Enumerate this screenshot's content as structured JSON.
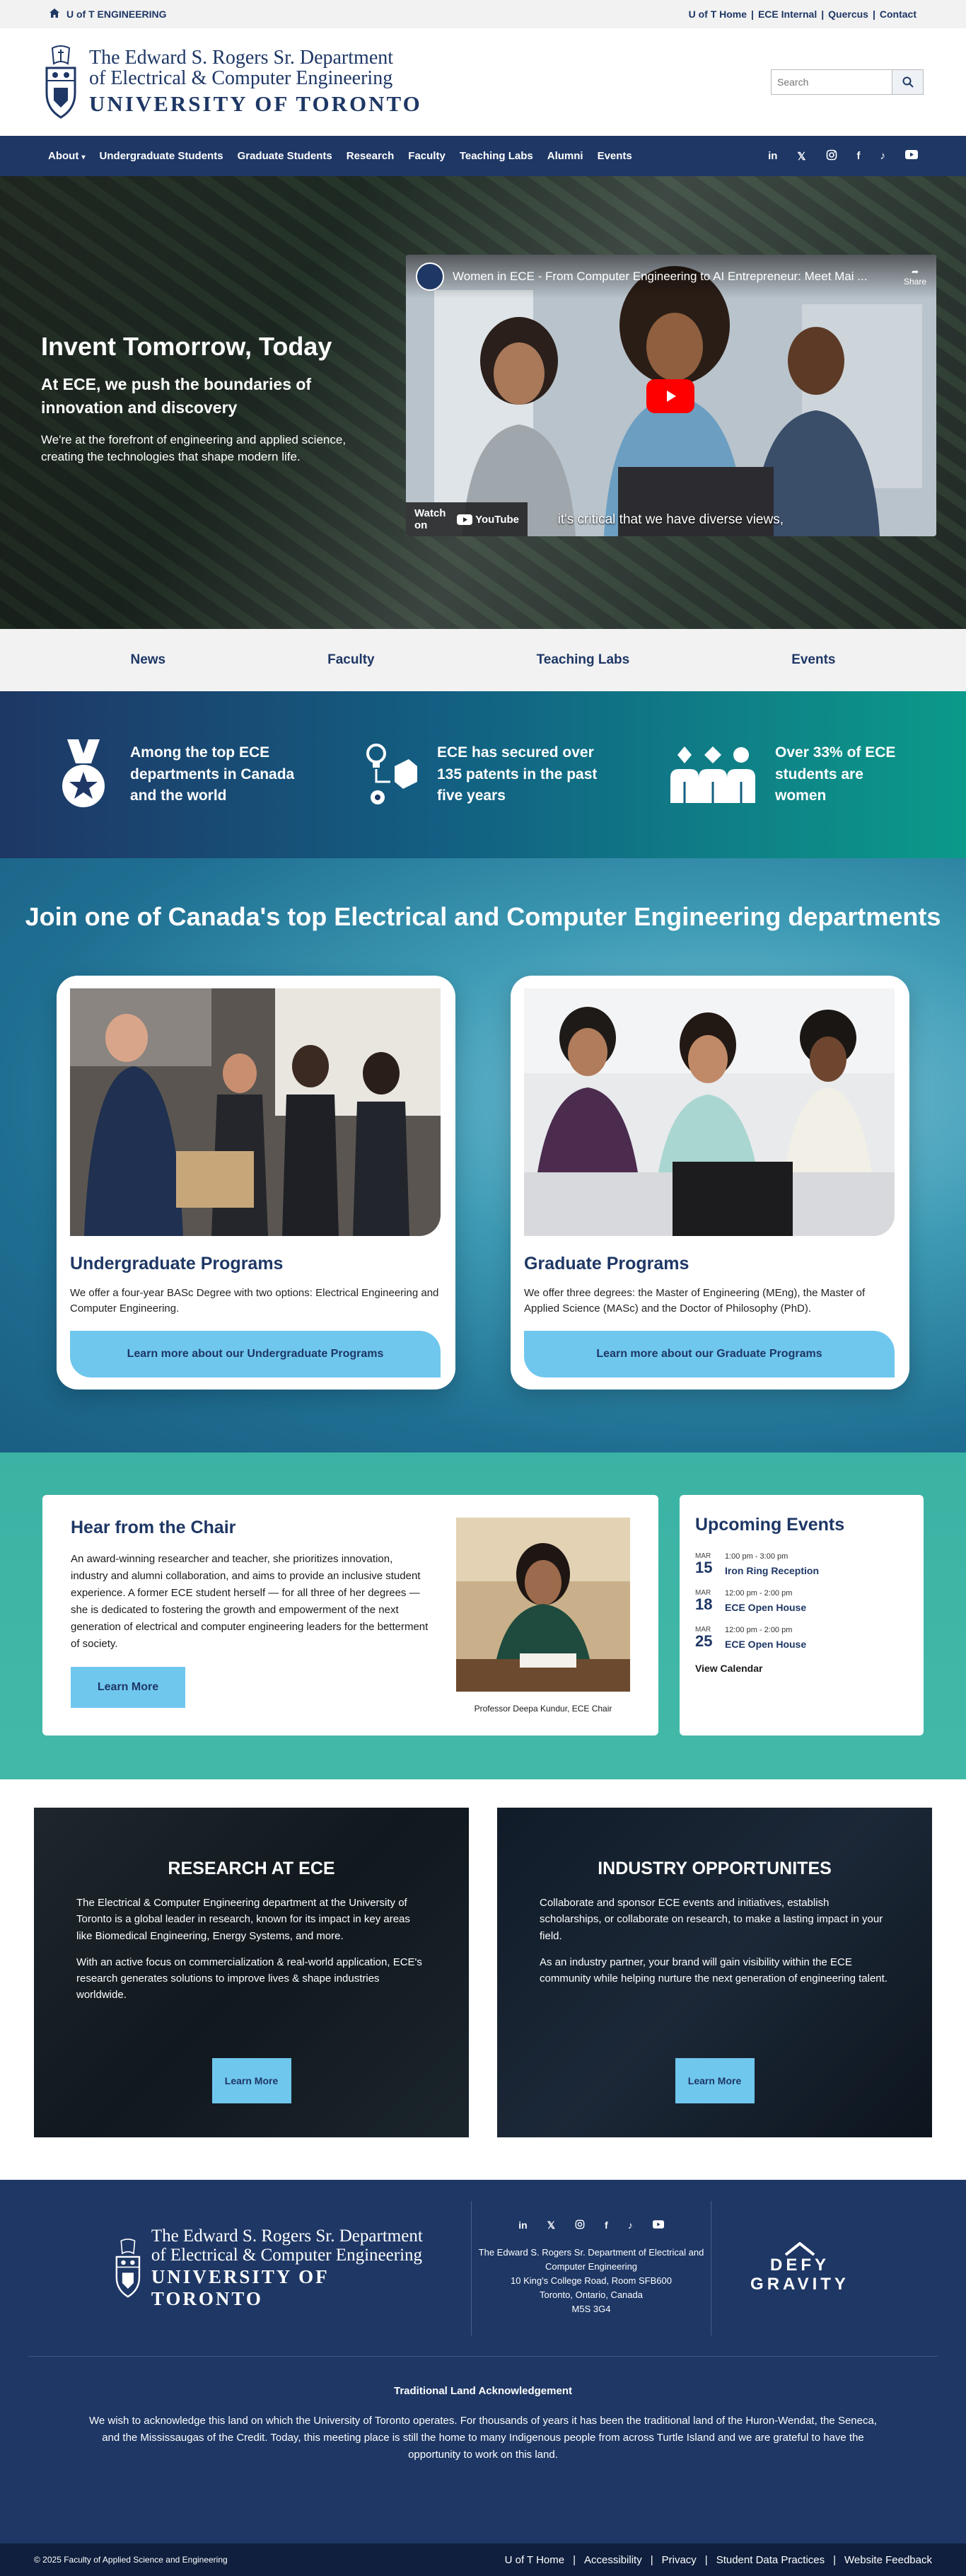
{
  "utility": {
    "brand": "U of T ENGINEERING",
    "links": [
      "U of T Home",
      "ECE Internal",
      "Quercus",
      "Contact"
    ]
  },
  "header": {
    "line1": "The Edward S. Rogers Sr. Department",
    "line2": "of Electrical & Computer Engineering",
    "line3": "UNIVERSITY OF TORONTO",
    "search_placeholder": "Search"
  },
  "nav": {
    "items": [
      "About",
      "Undergraduate Students",
      "Graduate Students",
      "Research",
      "Faculty",
      "Teaching Labs",
      "Alumni",
      "Events"
    ],
    "social": [
      "in",
      "X",
      "instagram",
      "f",
      "tiktok",
      "youtube"
    ]
  },
  "hero": {
    "title": "Invent Tomorrow, Today",
    "subtitle": "At ECE, we push the boundaries of innovation and discovery",
    "body": "We're at the forefront of engineering and applied science, creating the technologies that shape modern life.",
    "video_title": "Women in ECE - From Computer Engineering to AI Entrepreneur: Meet Mai ...",
    "video_share": "Share",
    "video_watch": "Watch on",
    "video_brand": "YouTube",
    "video_caption": "it's critical that we have diverse views,"
  },
  "quick": [
    "News",
    "Faculty",
    "Teaching Labs",
    "Events"
  ],
  "stats": [
    "Among the top ECE departments in Canada and the world",
    "ECE has secured over 135 patents in the past five years",
    "Over 33% of ECE students are women"
  ],
  "programs": {
    "heading": "Join one of Canada's top Electrical and Computer Engineering departments",
    "cards": [
      {
        "title": "Undergraduate Programs",
        "body": "We offer a four-year BASc Degree with two options: Electrical Engineering and Computer Engineering.",
        "button": "Learn more about our Undergraduate Programs"
      },
      {
        "title": "Graduate Programs",
        "body": "We offer three degrees: the Master of Engineering (MEng), the Master of Applied Science (MASc) and the Doctor of Philosophy (PhD).",
        "button": "Learn more about our Graduate Programs"
      }
    ]
  },
  "chair": {
    "title": "Hear from the Chair",
    "body": "An award-winning researcher and teacher, she prioritizes innovation, industry and alumni collaboration, and aims to provide an inclusive student experience. A former ECE student herself — for all three of her degrees — she is dedicated to fostering the growth and empowerment of the next generation of electrical and computer engineering leaders for the betterment of society.",
    "button": "Learn More",
    "caption": "Professor Deepa Kundur, ECE Chair"
  },
  "events": {
    "title": "Upcoming Events",
    "items": [
      {
        "month": "MAR",
        "day": "15",
        "time": "1:00 pm - 3:00 pm",
        "name": "Iron Ring Reception"
      },
      {
        "month": "MAR",
        "day": "18",
        "time": "12:00 pm - 2:00 pm",
        "name": "ECE Open House"
      },
      {
        "month": "MAR",
        "day": "25",
        "time": "12:00 pm - 2:00 pm",
        "name": "ECE Open House"
      }
    ],
    "view_all": "View Calendar"
  },
  "research": {
    "title": "RESEARCH AT ECE",
    "p1": "The Electrical & Computer Engineering department at the University of Toronto is a global leader in research, known for its impact in key areas like Biomedical Engineering, Energy Systems, and more.",
    "p2": "With an active focus on commercialization & real-world application, ECE's research generates solutions to improve lives & shape industries worldwide.",
    "button": "Learn More"
  },
  "industry": {
    "title": "INDUSTRY OPPORTUNITES",
    "p1": "Collaborate and sponsor ECE events and initiatives, establish scholarships, or collaborate on research, to make a lasting impact in your field.",
    "p2": "As an industry partner, your brand will gain visibility within the ECE community while helping nurture the next generation of engineering talent.",
    "button": "Learn More"
  },
  "footer": {
    "line1": "The Edward S. Rogers Sr. Department",
    "line2": "of Electrical & Computer Engineering",
    "line3": "UNIVERSITY OF TORONTO",
    "addr1": "The Edward S. Rogers Sr. Department of Electrical and Computer Engineering",
    "addr2": "10 King's College Road, Room SFB600",
    "addr3": "Toronto, Ontario, Canada",
    "addr4": "M5S 3G4",
    "defy1": "DEFY",
    "defy2": "GRAVITY",
    "land_title": "Traditional Land Acknowledgement",
    "land_body": "We wish to acknowledge this land on which the University of Toronto operates. For thousands of years it has been the traditional land of the Huron-Wendat, the Seneca, and the Mississaugas of the Credit. Today, this meeting place is still the home to many Indigenous people from across Turtle Island and we are grateful to have the opportunity to work on this land.",
    "copyright": "© 2025 Faculty of Applied Science and Engineering",
    "links": [
      "U of T Home",
      "Accessibility",
      "Privacy",
      "Student Data Practices",
      "Website Feedback"
    ]
  },
  "colors": {
    "navy": "#1e3765",
    "sky": "#6fc7ee",
    "teal": "#3bb3a4"
  }
}
